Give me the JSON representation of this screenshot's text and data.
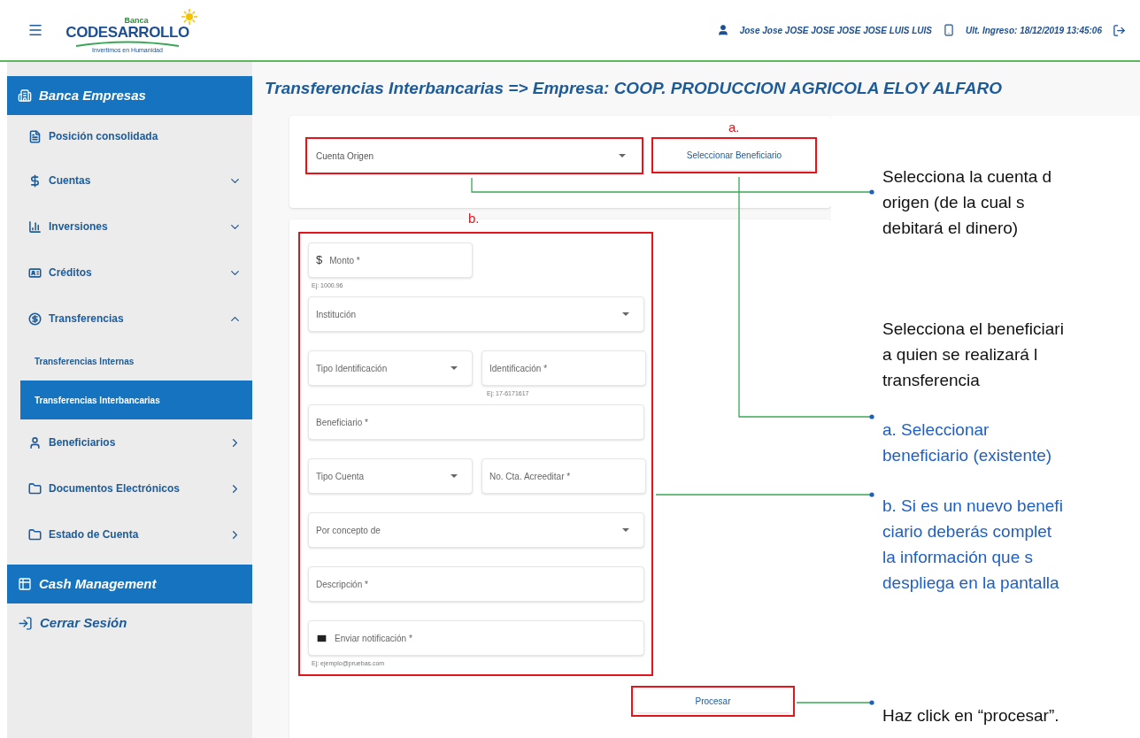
{
  "header": {
    "logo": {
      "top": "Banca",
      "name": "CODESARROLLO",
      "tagline": "Invertimos en Humanidad"
    },
    "user_name": "Jose Jose JOSE JOSE JOSE JOSE LUIS LUIS",
    "last_login": "Ult. Ingreso: 18/12/2019 13:45:06"
  },
  "sidebar": {
    "items": [
      {
        "kind": "section",
        "label": "Banca Empresas"
      },
      {
        "kind": "plain",
        "label": "Posición consolidada"
      },
      {
        "kind": "group",
        "label": "Cuentas",
        "expanded": false
      },
      {
        "kind": "group",
        "label": "Inversiones",
        "expanded": false
      },
      {
        "kind": "group",
        "label": "Créditos",
        "expanded": false
      },
      {
        "kind": "group",
        "label": "Transferencias",
        "expanded": true
      },
      {
        "kind": "subitem",
        "label": "Transferencias Internas",
        "selected": false
      },
      {
        "kind": "subitem",
        "label": "Transferencias Interbancarias",
        "selected": true
      },
      {
        "kind": "link",
        "label": "Beneficiarios"
      },
      {
        "kind": "link",
        "label": "Documentos Electrónicos"
      },
      {
        "kind": "link",
        "label": "Estado de Cuenta"
      },
      {
        "kind": "section",
        "label": "Cash Management"
      },
      {
        "kind": "logout",
        "label": "Cerrar Sesión"
      }
    ]
  },
  "page_title": "Transferencias Interbancarias => Empresa: COOP. PRODUCCION AGRICOLA ELOY ALFARO",
  "account_card": {
    "origin_select": "Cuenta Origen",
    "beneficiary_button": "Seleccionar Beneficiario",
    "callout": "a."
  },
  "form": {
    "callout": "b.",
    "rows": [
      [
        {
          "kind": "amount",
          "prefix": "$",
          "placeholder": "Monto *",
          "hint": "Ej: 1000.96"
        }
      ],
      [
        {
          "kind": "select",
          "label": "Institución"
        }
      ],
      [
        {
          "kind": "select",
          "label": "Tipo Identificación"
        },
        {
          "kind": "text",
          "placeholder": "Identificación *",
          "hint": "Ej: 17-6171617"
        }
      ],
      [
        {
          "kind": "text",
          "placeholder": "Beneficiario *"
        }
      ],
      [
        {
          "kind": "select",
          "label": "Tipo Cuenta"
        },
        {
          "kind": "text",
          "placeholder": "No. Cta. Acreeditar *"
        }
      ],
      [
        {
          "kind": "select",
          "label": "Por concepto de"
        }
      ],
      [
        {
          "kind": "text",
          "placeholder": "Descripción *"
        }
      ],
      [
        {
          "kind": "email",
          "placeholder": "Enviar notificación *",
          "hint": "Ej: ejemplo@pruebas.com"
        }
      ]
    ]
  },
  "process_button": "Procesar",
  "annotations": [
    {
      "kind": "note",
      "lines": [
        "Selecciona la cuenta d",
        "origen (de la cual s",
        "debitará el dinero)"
      ]
    },
    {
      "kind": "note",
      "lines": [
        "Selecciona el beneficiari",
        "a quien se realizará l",
        "transferencia"
      ]
    },
    {
      "kind": "step",
      "lines": [
        "a. Seleccionar",
        "beneficiario (existente)"
      ]
    },
    {
      "kind": "step",
      "lines": [
        "b. Si es un nuevo benefi",
        "ciario deberás complet",
        "la información que s",
        "despliega en la pantalla"
      ]
    },
    {
      "kind": "note",
      "lines": [
        "Haz click en “procesar”."
      ]
    }
  ]
}
